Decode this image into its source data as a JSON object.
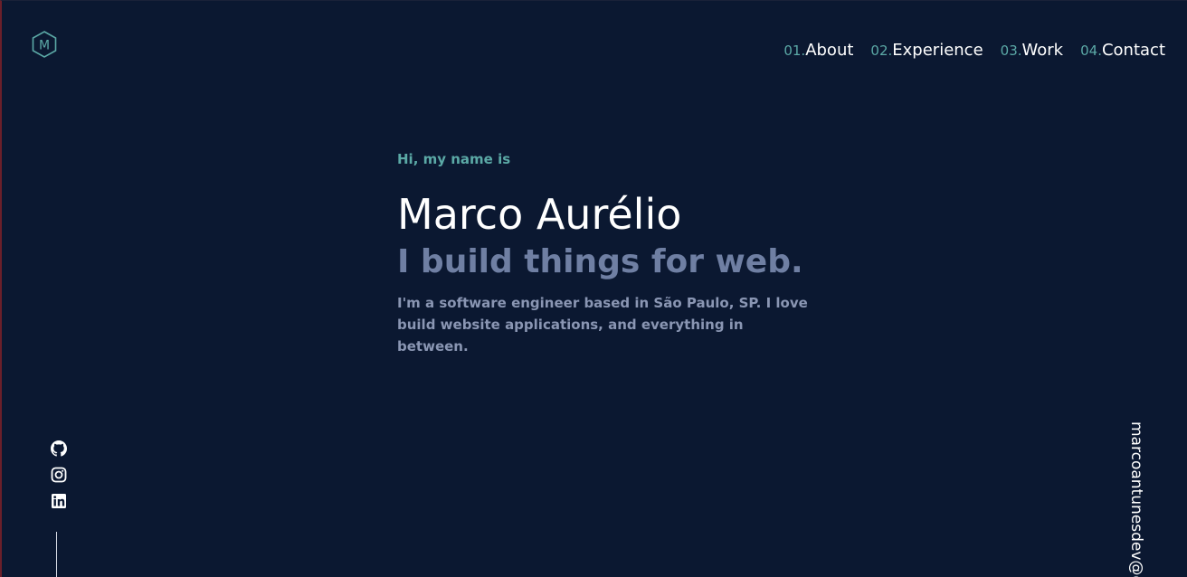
{
  "logo": {
    "letter": "M",
    "icon": "hexagon-logo-icon"
  },
  "nav": {
    "items": [
      {
        "num": "01.",
        "label": "About"
      },
      {
        "num": "02.",
        "label": "Experience"
      },
      {
        "num": "03.",
        "label": "Work"
      },
      {
        "num": "04.",
        "label": "Contact"
      }
    ]
  },
  "hero": {
    "greeting": "Hi, my name is",
    "name": "Marco Aurélio",
    "tagline": "I build things for web.",
    "bio": "I'm a software engineer based in São Paulo, SP. I love build website applications, and everything in between."
  },
  "social": {
    "icons": [
      "github-icon",
      "instagram-icon",
      "linkedin-icon"
    ]
  },
  "email": {
    "text": "marcoantunesdev@g"
  },
  "colors": {
    "background": "#0b1831",
    "accent": "#5ba9a6",
    "heading": "#ffffff",
    "muted": "#6f7fa3"
  }
}
